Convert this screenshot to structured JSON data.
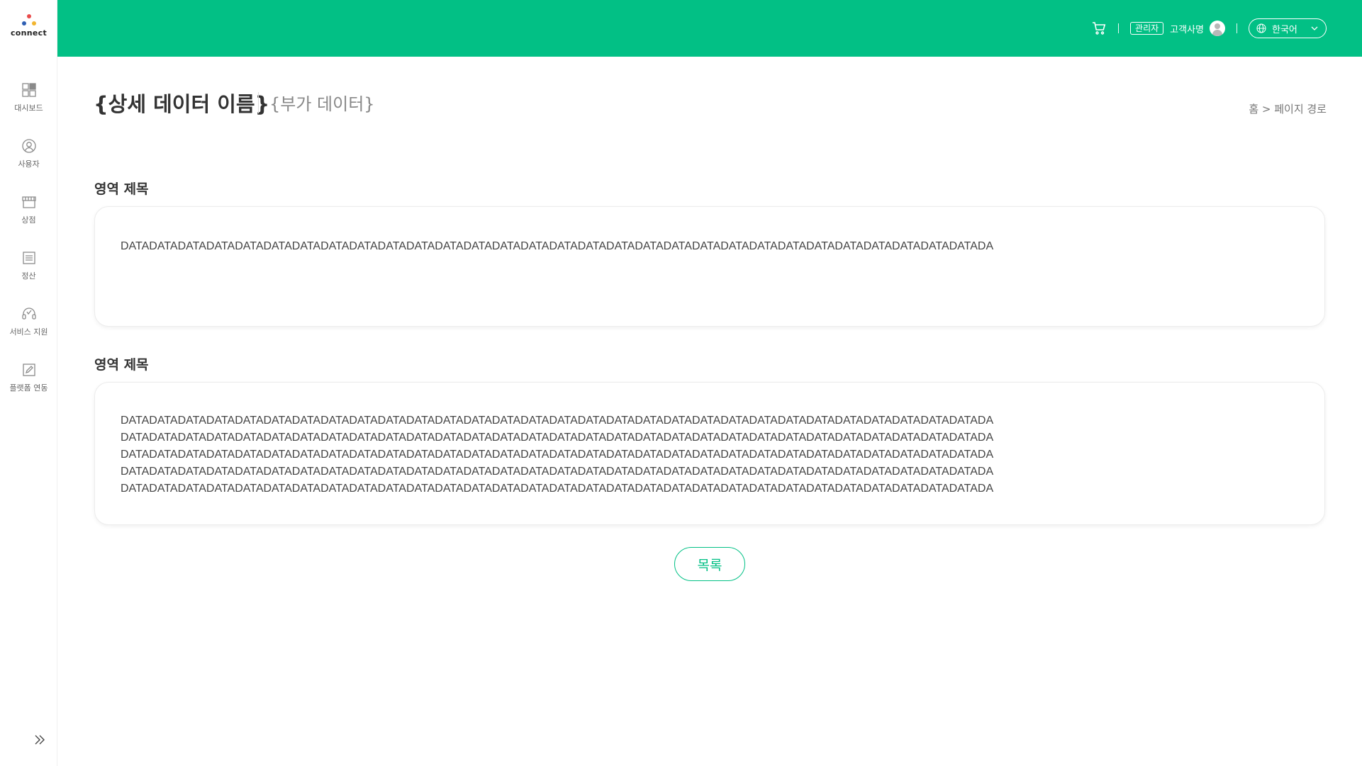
{
  "app": {
    "logo_text": "connect",
    "logo_colors": [
      "#e94b4b",
      "#2f5fb3",
      "#f2b530"
    ]
  },
  "sidebar": {
    "items": [
      {
        "label": "대시보드",
        "icon": "dashboard-icon"
      },
      {
        "label": "사용자",
        "icon": "user-icon"
      },
      {
        "label": "상점",
        "icon": "store-icon"
      },
      {
        "label": "정산",
        "icon": "settlement-icon"
      },
      {
        "label": "서비스 지원",
        "icon": "headset-icon"
      },
      {
        "label": "플랫폼 연동",
        "icon": "edit-icon"
      }
    ],
    "collapse_icon": "double-chevron-right-icon"
  },
  "header": {
    "role_badge": "관리자",
    "customer_name": "고객사명",
    "language": "한국어",
    "accent_color": "#02c085"
  },
  "page": {
    "title": "{상세 데이터 이름}",
    "subtitle": "{부가 데이터}",
    "breadcrumb": "홈 > 페이지 경로"
  },
  "sections": [
    {
      "title": "영역 제목",
      "lines": [
        "DATADATADATADATADATADATADATADATADATADATADATADATADATADATADATADATADATADATADATADATADATADATADATADATADATADATADATADATADATADATADA"
      ]
    },
    {
      "title": "영역 제목",
      "lines": [
        "DATADATADATADATADATADATADATADATADATADATADATADATADATADATADATADATADATADATADATADATADATADATADATADATADATADATADATADATADATADATADA",
        "DATADATADATADATADATADATADATADATADATADATADATADATADATADATADATADATADATADATADATADATADATADATADATADATADATADATADATADATADATADATADA",
        "DATADATADATADATADATADATADATADATADATADATADATADATADATADATADATADATADATADATADATADATADATADATADATADATADATADATADATADATADATADATADA",
        "DATADATADATADATADATADATADATADATADATADATADATADATADATADATADATADATADATADATADATADATADATADATADATADATADATADATADATADATADATADATADA",
        "DATADATADATADATADATADATADATADATADATADATADATADATADATADATADATADATADATADATADATADATADATADATADATADATADATADATADATADATADATADATADA"
      ]
    }
  ],
  "actions": {
    "list_button": "목록"
  }
}
